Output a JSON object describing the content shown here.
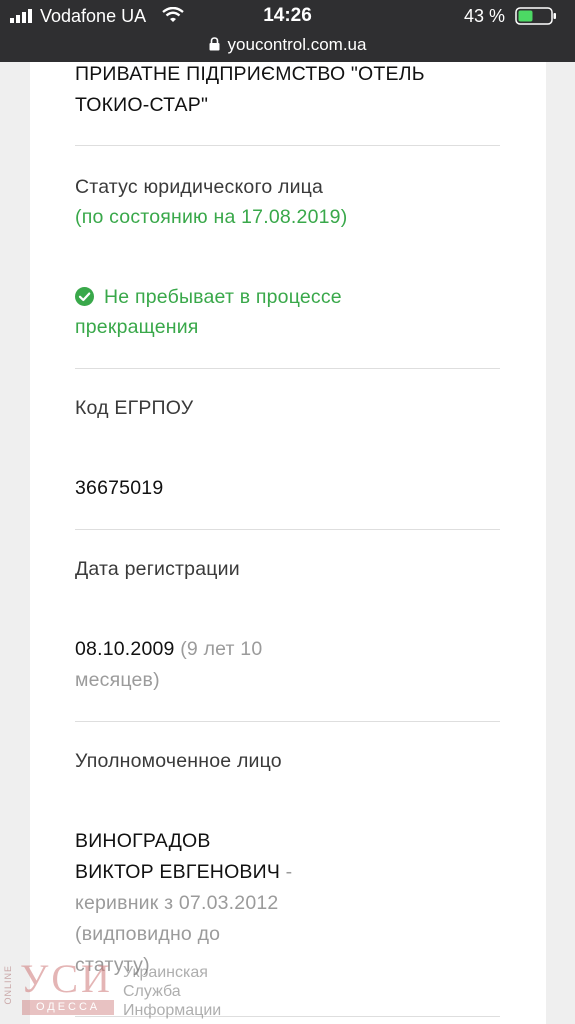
{
  "status_bar": {
    "carrier": "Vodafone UA",
    "time": "14:26",
    "battery": "43 %"
  },
  "url_bar": {
    "url": "youcontrol.com.ua"
  },
  "company": {
    "name_line1": "ПРИВАТНЕ ПІДПРИЄМСТВО \"ОТЕЛЬ",
    "name_line2": "ТОКИО-СТАР\""
  },
  "status": {
    "label": "Статус юридического лица",
    "date_note": "(по состоянию на 17.08.2019)",
    "value_line1": "Не пребывает в процессе",
    "value_line2": "прекращения"
  },
  "edrpou": {
    "label": "Код ЕГРПОУ",
    "value": "36675019"
  },
  "registration": {
    "label": "Дата регистрации",
    "date": "08.10.2009",
    "age_part1": " (9 лет 10",
    "age_part2": "месяцев)"
  },
  "authorized": {
    "label": "Уполномоченное лицо",
    "name_line1": "ВИНОГРАДОВ",
    "name_line2": "ВИКТОР ЕВГЕНОВИЧ",
    "dash": " -",
    "role_line1": "керивник з 07.03.2012",
    "role_line2": "(видповидно до",
    "role_line3": "статуту)"
  },
  "watermark": {
    "online": "ONLINE",
    "logo": "УСИ",
    "city": "ОДЕССА",
    "line1": "Украинская",
    "line2": "Служба",
    "line3": "Информации"
  },
  "colors": {
    "status_bar_bg": "#2f2f31",
    "accent_green": "#39a84a",
    "battery_green": "#4cd964"
  }
}
